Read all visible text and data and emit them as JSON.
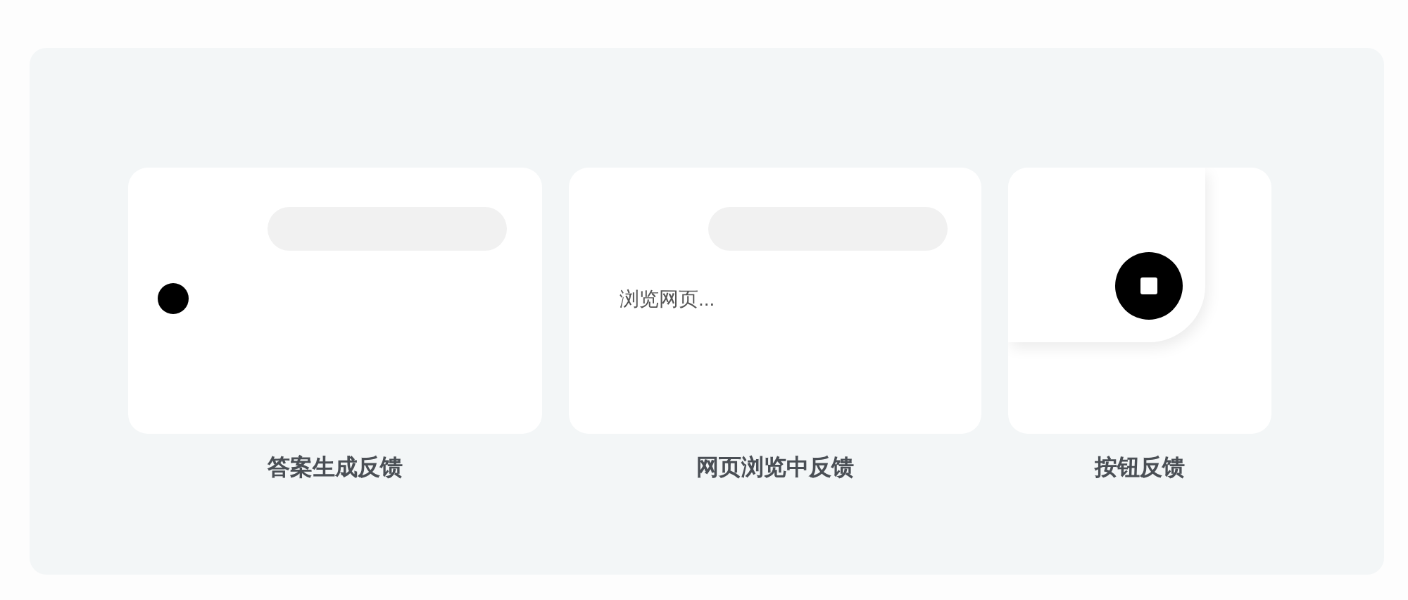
{
  "cards": [
    {
      "kind": "answer",
      "caption": "答案生成反馈"
    },
    {
      "kind": "browsing",
      "status_text": "浏览网页...",
      "caption": "网页浏览中反馈"
    },
    {
      "kind": "button",
      "caption": "按钮反馈"
    }
  ]
}
